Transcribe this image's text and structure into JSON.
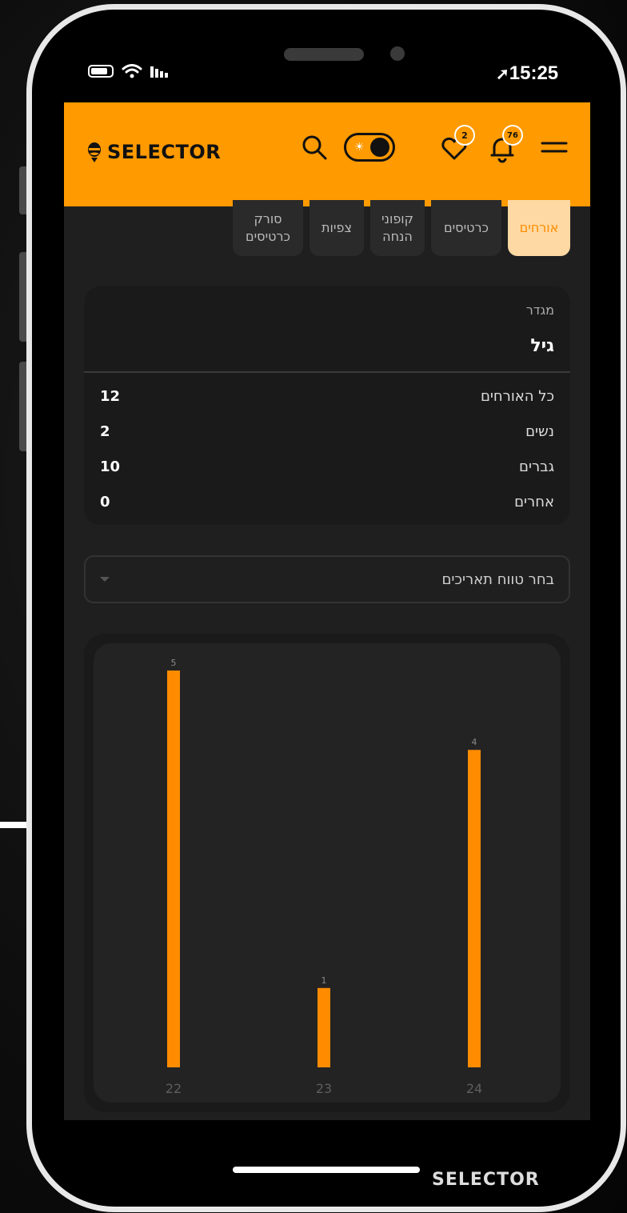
{
  "status_bar": {
    "time": "15:25",
    "location_arrow": "location-arrow-icon"
  },
  "header": {
    "brand": "SELECTOR",
    "favorites_count": "2",
    "notifications_count": "76",
    "colors": {
      "accent": "#ff9a00"
    }
  },
  "tabs": [
    {
      "label": "אורחים",
      "active": true
    },
    {
      "label": "כרטיסים",
      "active": false
    },
    {
      "label": "קופוני הנחה",
      "active": false
    },
    {
      "label": "צפיות",
      "active": false
    },
    {
      "label": "סורק כרטיסים",
      "active": false
    }
  ],
  "summary_card": {
    "small_label": "מגדר",
    "title": "גיל",
    "rows": [
      {
        "label": "כל האורחים",
        "value": "12"
      },
      {
        "label": "נשים",
        "value": "2"
      },
      {
        "label": "גברים",
        "value": "10"
      },
      {
        "label": "אחרים",
        "value": "0"
      }
    ]
  },
  "date_range": {
    "placeholder": "בחר טווח תאריכים"
  },
  "chart_data": {
    "type": "bar",
    "categories": [
      "22",
      "23",
      "24"
    ],
    "values": [
      5,
      1,
      4
    ],
    "title": "",
    "xlabel": "",
    "ylabel": "",
    "ylim": [
      0,
      5
    ],
    "grid": false,
    "bar_color": "#ff8c00"
  },
  "footer": {
    "brand": "SELECTOR"
  }
}
